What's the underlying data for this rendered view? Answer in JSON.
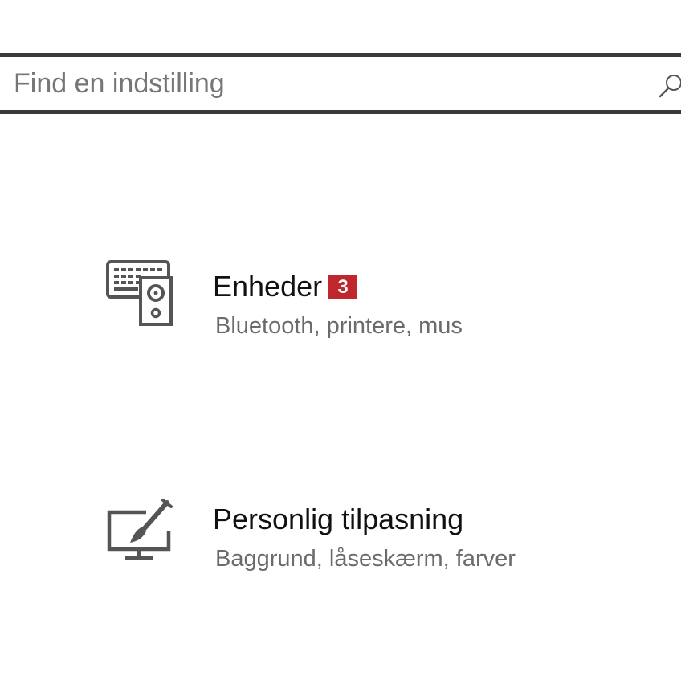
{
  "search": {
    "placeholder": "Find en indstilling",
    "icon": "search-icon"
  },
  "items": [
    {
      "title": "Enheder",
      "subtitle": "Bluetooth, printere, mus",
      "icon": "devices-icon",
      "badge": "3"
    },
    {
      "title": "Personlig tilpasning",
      "subtitle": "Baggrund, låseskærm, farver",
      "icon": "personalization-icon"
    }
  ],
  "colors": {
    "badge_background": "#c0272d",
    "subtitle_text": "#6b6b6b",
    "search_border": "#3a3a3a"
  }
}
